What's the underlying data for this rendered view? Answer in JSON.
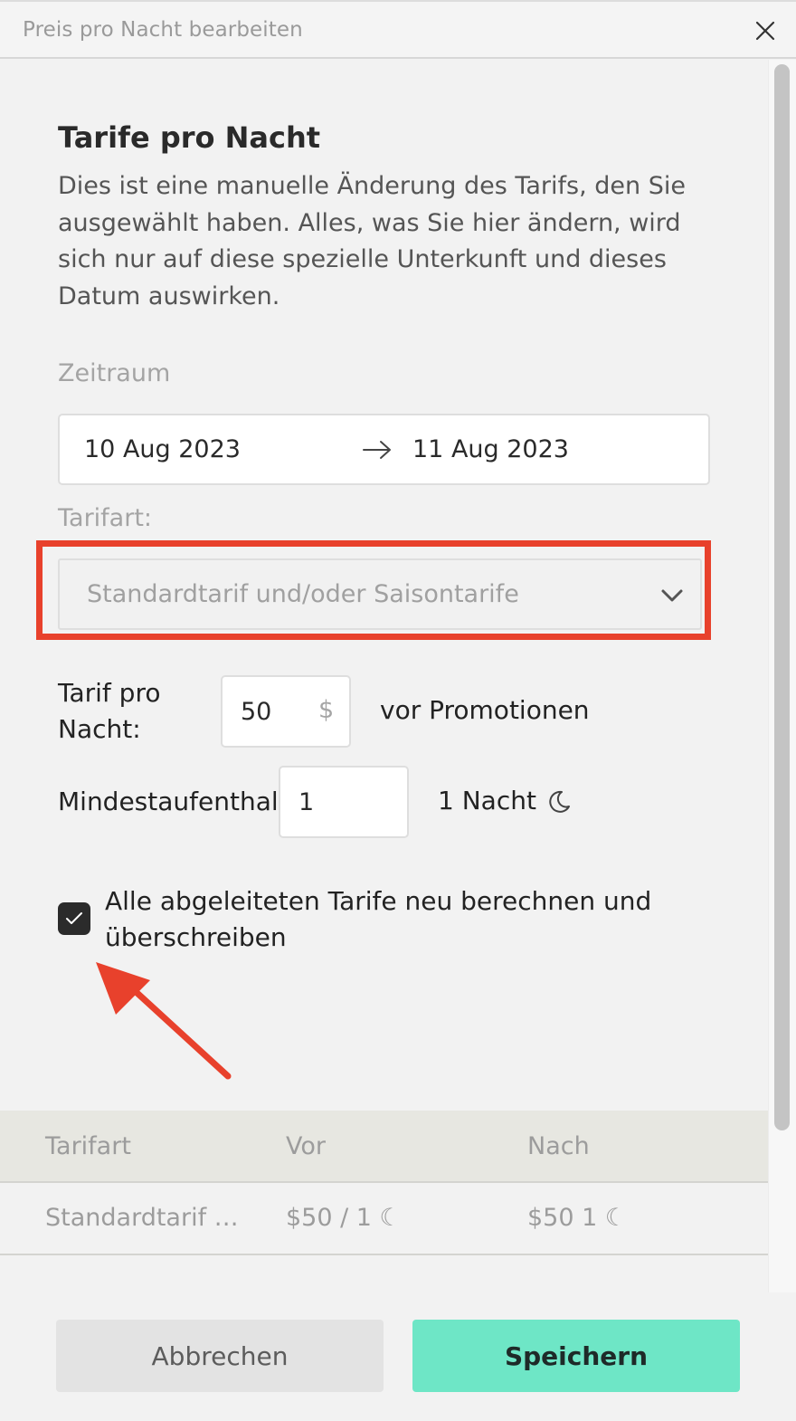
{
  "dialog": {
    "title": "Preis pro Nacht bearbeiten"
  },
  "content": {
    "heading": "Tarife pro Nacht",
    "description": "Dies ist eine manuelle Änderung des Tarifs, den Sie ausgewählt haben. Alles, was Sie hier ändern, wird sich nur auf diese spezielle Unterkunft und dieses Datum auswirken.",
    "period": {
      "label": "Zeitraum",
      "start": "10 Aug 2023",
      "end": "11 Aug 2023"
    },
    "rate_type": {
      "label": "Tarifart:",
      "selected": "Standardtarif und/oder Saisontarife"
    },
    "rate_per_night": {
      "label": "Tarif pro Nacht:",
      "value": "50",
      "currency": "$",
      "note": "vor Promotionen"
    },
    "min_stay": {
      "label": "Mindestaufenthalt",
      "value": "1",
      "note": "1 Nacht"
    },
    "recalculate": {
      "checked": true,
      "label": "Alle abgeleiteten Tarife neu berechnen und überschreiben"
    }
  },
  "table": {
    "columns": [
      "Tarifart",
      "Vor",
      "Nach"
    ],
    "rows": [
      [
        "Standardtarif …",
        "$50 / 1 ☾",
        "$50  1 ☾"
      ]
    ]
  },
  "footer": {
    "cancel_label": "Abbrechen",
    "save_label": "Speichern"
  },
  "colors": {
    "annotation_red": "#e8412c",
    "save_accent": "#6ee6c6",
    "checkbox_dark": "#2b2b2b"
  }
}
